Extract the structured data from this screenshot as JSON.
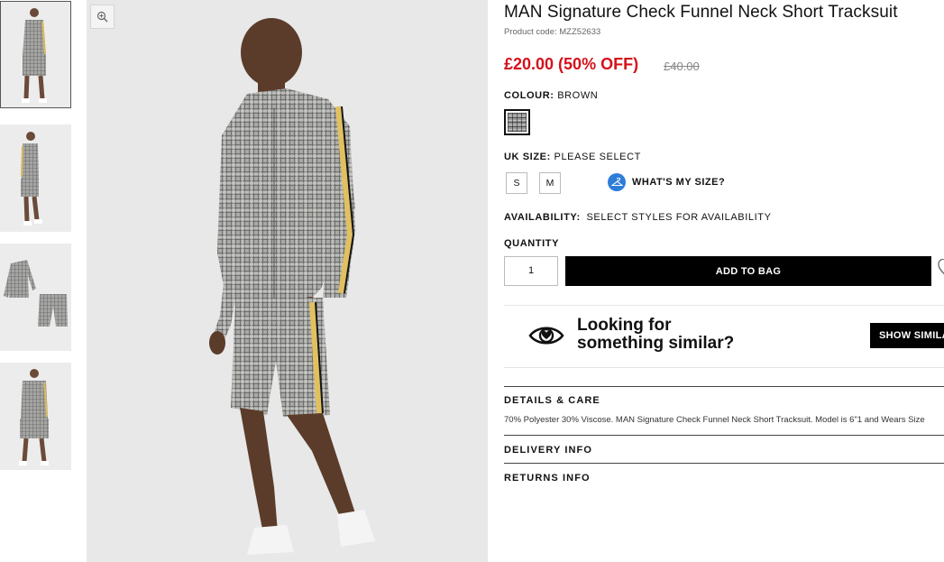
{
  "product": {
    "title": "MAN Signature Check Funnel Neck Short Tracksuit",
    "code_label": "Product code:",
    "code": "MZZ52633",
    "price": "£20.00 (50% OFF)",
    "old_price": "£40.00"
  },
  "colour": {
    "label": "COLOUR:",
    "value": "BROWN"
  },
  "size": {
    "label": "UK SIZE:",
    "value": "PLEASE SELECT",
    "options": [
      "S",
      "M"
    ],
    "whats_my_size": "WHAT'S MY SIZE?"
  },
  "availability": {
    "label": "AVAILABILITY:",
    "value": "SELECT STYLES FOR AVAILABILITY"
  },
  "quantity": {
    "label": "QUANTITY",
    "value": "1"
  },
  "add_to_bag": "ADD TO BAG",
  "similar": {
    "line1": "Looking for",
    "line2": "something similar?",
    "button": "SHOW SIMILAR"
  },
  "details": {
    "heading": "DETAILS & CARE",
    "text": "70% Polyester 30% Viscose. MAN Signature Check Funnel Neck Short Tracksuit. Model is 6\"1 and Wears Size"
  },
  "delivery": {
    "heading": "DELIVERY INFO"
  },
  "returns": {
    "heading": "RETURNS INFO"
  },
  "colors": {
    "price_red": "#d4111b",
    "accent_blue": "#2e7ed9",
    "button_black": "#000000"
  },
  "icons": [
    "zoom-icon",
    "hanger-icon",
    "eye-heart-icon",
    "heart-icon"
  ]
}
